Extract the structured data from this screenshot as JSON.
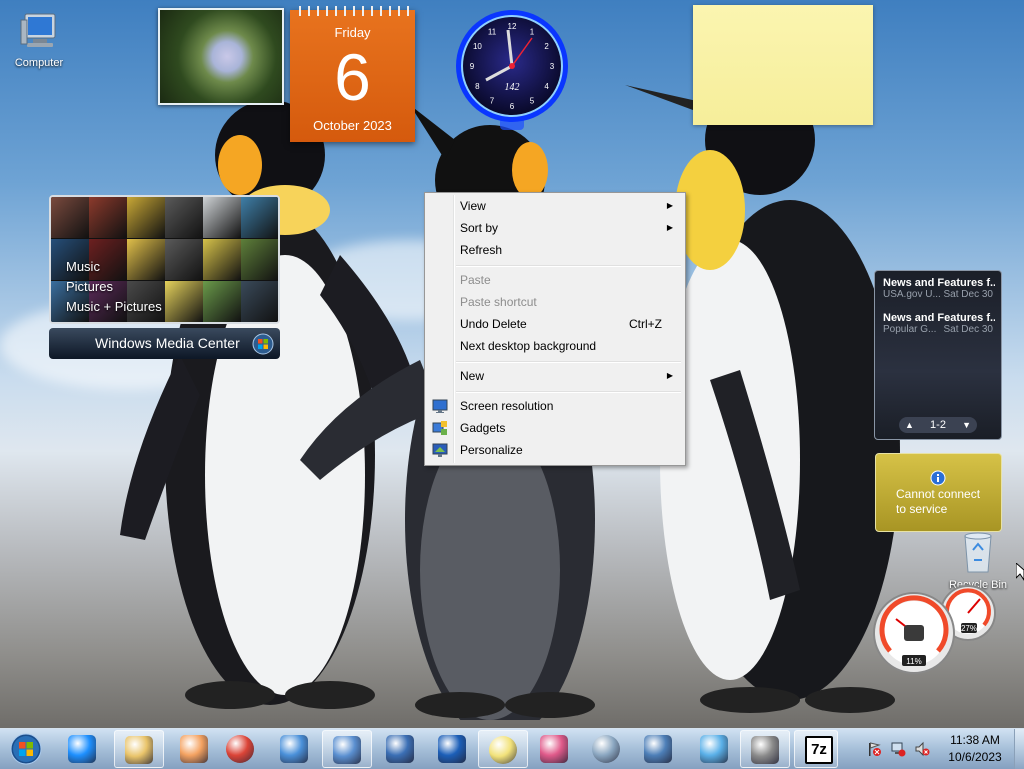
{
  "desktop": {
    "icons": [
      {
        "label": "Computer",
        "icon": "computer-icon"
      },
      {
        "label": "Recycle Bin",
        "icon": "recycle-bin-icon"
      }
    ]
  },
  "gadgets": {
    "calendar": {
      "weekday": "Friday",
      "day": "6",
      "month_year": "October 2023"
    },
    "clock": {
      "label": "142",
      "numerals": [
        "12",
        "1",
        "2",
        "3",
        "4",
        "5",
        "6",
        "7",
        "8",
        "9",
        "10",
        "11"
      ]
    },
    "media_center": {
      "menu": [
        "Music",
        "Pictures",
        "Music + Pictures"
      ],
      "brand_bold": "Windows",
      "brand_light": "Media Center"
    },
    "news": {
      "items": [
        {
          "title": "News and Features f...",
          "source": "USA.gov U...",
          "date": "Sat Dec 30"
        },
        {
          "title": "News and Features f...",
          "source": "Popular G...",
          "date": "Sat Dec 30"
        }
      ],
      "pager": "1-2"
    },
    "weather": {
      "message_line1": "Cannot connect",
      "message_line2": "to service"
    },
    "cpu_meter": {
      "cpu": "11%",
      "memory": "27%"
    }
  },
  "context_menu": {
    "items": [
      {
        "label": "View",
        "submenu": true,
        "enabled": true
      },
      {
        "label": "Sort by",
        "submenu": true,
        "enabled": true
      },
      {
        "label": "Refresh",
        "submenu": false,
        "enabled": true
      },
      {
        "label": "Paste",
        "submenu": false,
        "enabled": false
      },
      {
        "label": "Paste shortcut",
        "submenu": false,
        "enabled": false
      },
      {
        "label": "Undo Delete",
        "shortcut": "Ctrl+Z",
        "submenu": false,
        "enabled": true
      },
      {
        "label": "Next desktop background",
        "submenu": false,
        "enabled": true
      },
      {
        "label": "New",
        "submenu": true,
        "enabled": true
      },
      {
        "label": "Screen resolution",
        "icon": "screen-resolution-icon",
        "enabled": true
      },
      {
        "label": "Gadgets",
        "icon": "gadgets-icon",
        "enabled": true
      },
      {
        "label": "Personalize",
        "icon": "personalize-icon",
        "enabled": true
      }
    ]
  },
  "taskbar": {
    "start_icon": "windows-start-orb-icon",
    "pinned": [
      {
        "name": "internet-explorer-icon"
      },
      {
        "name": "file-explorer-icon"
      },
      {
        "name": "media-player-icon"
      },
      {
        "name": "chrome-icon"
      },
      {
        "name": "remote-desktop-icon"
      },
      {
        "name": "control-panel-icon"
      },
      {
        "name": "network-icon"
      },
      {
        "name": "help-icon"
      },
      {
        "name": "sticky-notes-icon"
      },
      {
        "name": "snipping-tool-icon"
      },
      {
        "name": "calculator-icon"
      },
      {
        "name": "magnifier-icon"
      },
      {
        "name": "paper-plane-icon"
      },
      {
        "name": "firewall-icon"
      },
      {
        "name": "7zip-icon",
        "text": "7z"
      }
    ],
    "tray": {
      "icons": [
        "action-center-icon",
        "network-status-icon",
        "volume-muted-icon"
      ],
      "time": "11:38 AM",
      "date": "10/6/2023"
    }
  },
  "colors": {
    "calendar_orange": "#e06a16",
    "clock_blue": "#1e4fff",
    "sticky_yellow": "#f8f0a0",
    "menu_bg": "#f0f0f0",
    "taskbar_tint": "#9fbad6"
  }
}
